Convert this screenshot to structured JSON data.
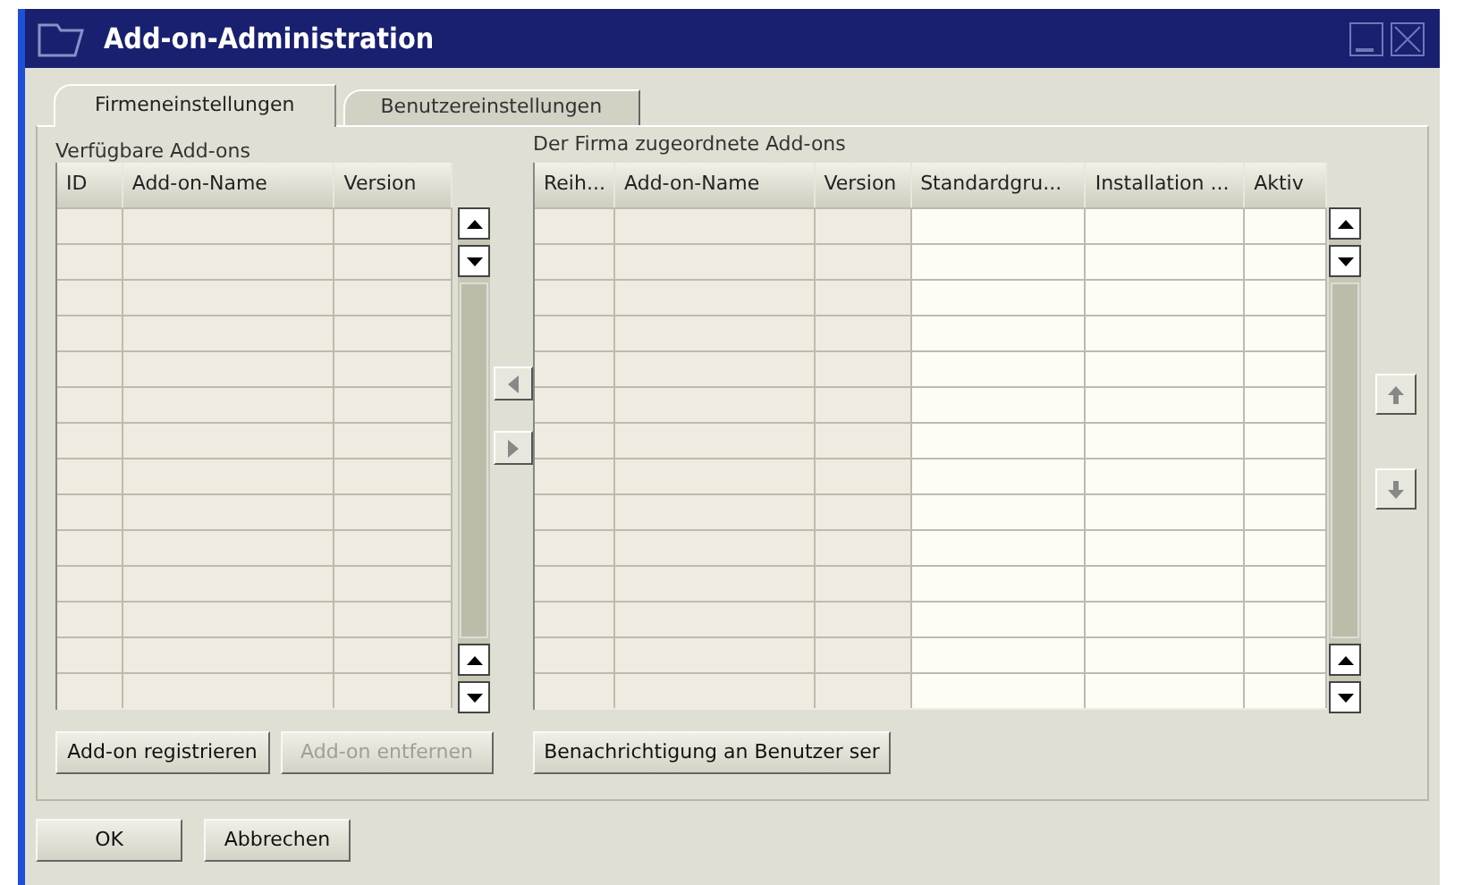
{
  "window": {
    "title": "Add-on-Administration"
  },
  "tabs": [
    {
      "label": "Firmeneinstellungen",
      "selected": true
    },
    {
      "label": "Benutzereinstellungen",
      "selected": false
    }
  ],
  "available": {
    "label": "Verfügbare Add-ons",
    "columns": [
      "ID",
      "Add-on-Name",
      "Version"
    ]
  },
  "assigned": {
    "label": "Der Firma zugeordnete Add-ons",
    "columns": [
      "Reih...",
      "Add-on-Name",
      "Version",
      "Standardgru...",
      "Installation ...",
      "Aktiv"
    ]
  },
  "panel_buttons": [
    {
      "label": "Add-on registrieren",
      "disabled": false
    },
    {
      "label": "Add-on entfernen",
      "disabled": true
    },
    {
      "label": "Benachrichtigung an Benutzer ser",
      "disabled": false
    }
  ],
  "dialog_buttons": [
    "OK",
    "Abbrechen"
  ]
}
